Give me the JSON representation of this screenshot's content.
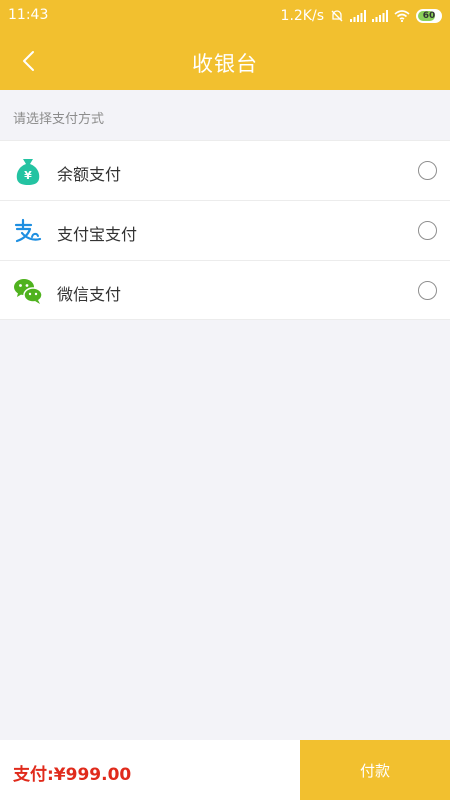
{
  "status_bar": {
    "time": "11:43",
    "network_speed": "1.2K/s",
    "battery_level": "60",
    "icons": [
      "mute-icon",
      "signal-icon",
      "signal-icon",
      "wifi-icon",
      "battery-icon"
    ]
  },
  "header": {
    "title": "收银台",
    "back_icon": "chevron-left-icon"
  },
  "section": {
    "label": "请选择支付方式"
  },
  "payment_methods": [
    {
      "label": "余额支付",
      "icon": "money-bag-icon",
      "selected": false
    },
    {
      "label": "支付宝支付",
      "icon": "alipay-icon",
      "selected": false
    },
    {
      "label": "微信支付",
      "icon": "wechat-icon",
      "selected": false
    }
  ],
  "footer": {
    "total": "支付:¥999.00",
    "pay_button": "付款"
  },
  "colors": {
    "brand": "#f2c02f",
    "price": "#e02a1b",
    "background": "#f3f3f8",
    "wechat": "#4fb21e",
    "alipay": "#1e8fe1",
    "balance": "#24c3a2"
  }
}
